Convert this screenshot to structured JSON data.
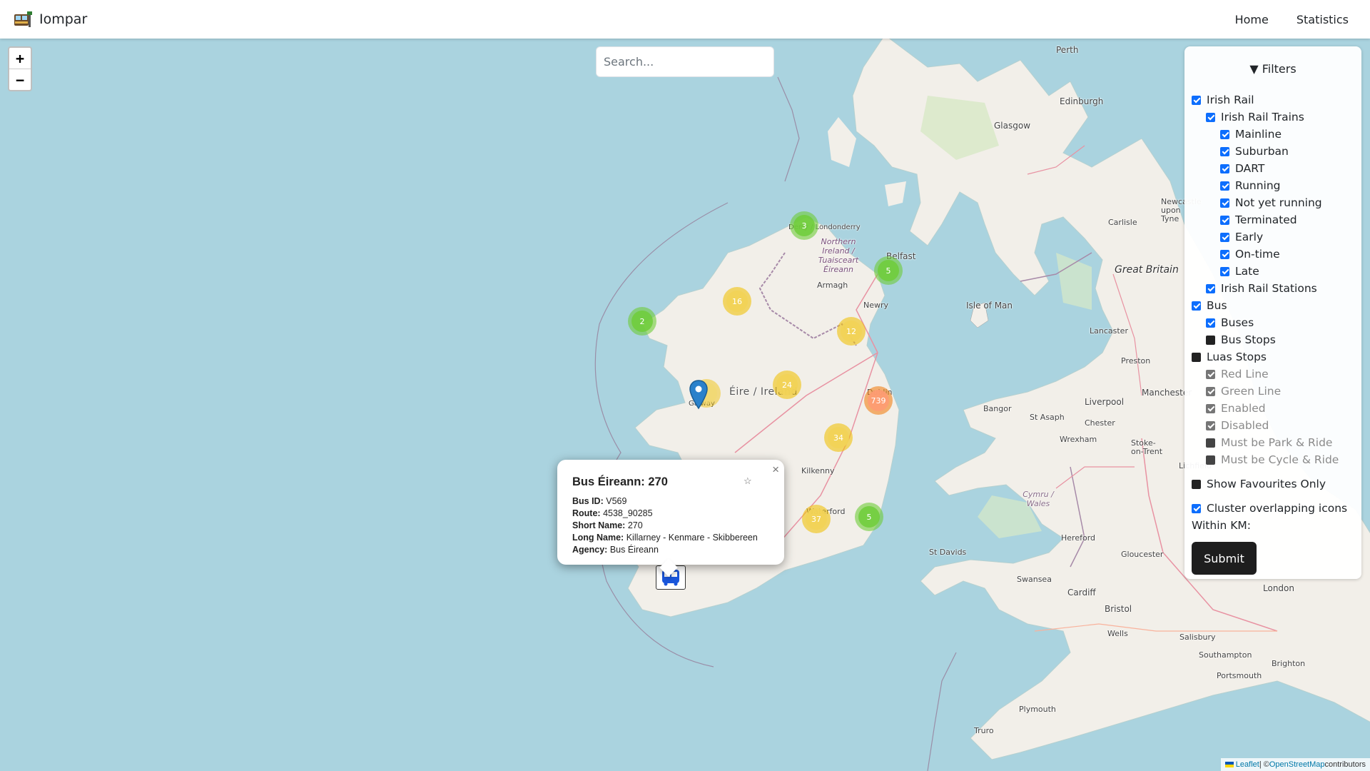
{
  "app": {
    "title": "Iompar",
    "logo": "bus-stop-logo-icon"
  },
  "nav": {
    "links": [
      {
        "label": "Home"
      },
      {
        "label": "Statistics"
      }
    ]
  },
  "zoom": {
    "in_label": "+",
    "out_label": "−"
  },
  "search": {
    "placeholder": "Search..."
  },
  "filters": {
    "title": "▼ Filters",
    "items": [
      {
        "label": "Irish Rail",
        "checked": true
      },
      {
        "label": "Irish Rail Trains",
        "checked": true
      },
      {
        "label": "Mainline",
        "checked": true
      },
      {
        "label": "Suburban",
        "checked": true
      },
      {
        "label": "DART",
        "checked": true
      },
      {
        "label": "Running",
        "checked": true
      },
      {
        "label": "Not yet running",
        "checked": true
      },
      {
        "label": "Terminated",
        "checked": true
      },
      {
        "label": "Early",
        "checked": true
      },
      {
        "label": "On-time",
        "checked": true
      },
      {
        "label": "Late",
        "checked": true
      },
      {
        "label": "Irish Rail Stations",
        "checked": true
      },
      {
        "label": "Bus",
        "checked": true
      },
      {
        "label": "Buses",
        "checked": true
      },
      {
        "label": "Bus Stops",
        "checked": false
      },
      {
        "label": "Luas Stops",
        "checked": false
      },
      {
        "label": "Red Line",
        "checked": true,
        "disabled": true
      },
      {
        "label": "Green Line",
        "checked": true,
        "disabled": true
      },
      {
        "label": "Enabled",
        "checked": true,
        "disabled": true
      },
      {
        "label": "Disabled",
        "checked": true,
        "disabled": true
      },
      {
        "label": "Must be Park & Ride",
        "checked": false,
        "disabled": true
      },
      {
        "label": "Must be Cycle & Ride",
        "checked": false,
        "disabled": true
      },
      {
        "label": "Show Favourites Only",
        "checked": false
      },
      {
        "label": "Cluster overlapping icons",
        "checked": true
      }
    ],
    "within_label": "Within KM:",
    "submit_label": "Submit"
  },
  "popup": {
    "title": "Bus Éireann: 270",
    "close": "×",
    "star": "☆",
    "fields": [
      {
        "key": "Bus ID:",
        "value": "V569"
      },
      {
        "key": "Route:",
        "value": "4538_90285"
      },
      {
        "key": "Short Name:",
        "value": "270"
      },
      {
        "key": "Long Name:",
        "value": "Killarney - Kenmare - Skibbereen"
      },
      {
        "key": "Agency:",
        "value": "Bus Éireann"
      }
    ]
  },
  "clusters": [
    {
      "count": "3",
      "level": "green"
    },
    {
      "count": "5",
      "level": "green"
    },
    {
      "count": "16",
      "level": "yellow"
    },
    {
      "count": "2",
      "level": "green"
    },
    {
      "count": "12",
      "level": "yellow"
    },
    {
      "count": "24",
      "level": "yellow"
    },
    {
      "count": "739",
      "level": "orange"
    },
    {
      "count": "34",
      "level": "yellow"
    },
    {
      "count": "37",
      "level": "yellow"
    },
    {
      "count": "5",
      "level": "green"
    }
  ],
  "places": {
    "perth": "Perth",
    "edinburgh": "Edinburgh",
    "glasgow": "Glasgow",
    "derry": "Derry / Londonderry",
    "ni": "Northern Ireland / Tuaisceart Éireann",
    "belfast": "Belfast",
    "armagh": "Armagh",
    "newry": "Newry",
    "iom": "Isle of Man",
    "gb": "Great Britain",
    "newcastle": "Newcastle upon Tyne",
    "carlisle": "Carlisle",
    "ireland": "Éire / Ireland",
    "galway": "Galway",
    "dublin": "Dublin",
    "kilkenny": "Kilkenny",
    "waterford": "Waterford",
    "lancaster": "Lancaster",
    "preston": "Preston",
    "liverpool": "Liverpool",
    "manchester": "Manchester",
    "bangor": "Bangor",
    "stasaph": "St Asaph",
    "chester": "Chester",
    "wrexham": "Wrexham",
    "stoke": "Stoke-on-Trent",
    "lichfield": "Lichfield",
    "wales": "Cymru / Wales",
    "hereford": "Hereford",
    "gloucester": "Gloucester",
    "stdavids": "St Davids",
    "swansea": "Swansea",
    "cardiff": "Cardiff",
    "bristol": "Bristol",
    "wells": "Wells",
    "salisbury": "Salisbury",
    "southampton": "Southampton",
    "portsmouth": "Portsmouth",
    "brighton": "Brighton",
    "london": "London",
    "plymouth": "Plymouth",
    "truro": "Truro"
  },
  "attribution": {
    "leaflet": "Leaflet",
    "sep": " | © ",
    "osm": "OpenStreetMap",
    "rest": " contributors"
  },
  "colors": {
    "sea": "#aad3df",
    "land": "#f2efe9",
    "primary": "#0d6efd",
    "submit": "#1e1e1e"
  }
}
